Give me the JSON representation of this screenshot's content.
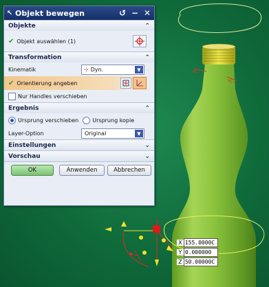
{
  "dialog": {
    "title": "Objekt bewegen",
    "sections": {
      "objekte": {
        "title": "Objekte",
        "select_label": "Objekt auswählen (1)"
      },
      "transformation": {
        "title": "Transformation",
        "kinematik_label": "Kinematik",
        "kinematik_value": "Dyn.",
        "orientation_label": "Orientierung angeben",
        "handles_label": "Nur Handles verschieben"
      },
      "ergebnis": {
        "title": "Ergebnis",
        "radio_move": "Ursprung verschieben",
        "radio_copy": "Ursprung kopie",
        "layer_label": "Layer-Option",
        "layer_value": "Original"
      },
      "einstellungen": {
        "title": "Einstellungen"
      },
      "vorschau": {
        "title": "Vorschau"
      }
    },
    "buttons": {
      "ok": "OK",
      "apply": "Anwenden",
      "cancel": "Abbrechen"
    }
  },
  "coordinates": {
    "x_label": "X",
    "x_value": "155.0000C",
    "y_label": "Y",
    "y_value": "0.000000",
    "z_label": "Z",
    "z_value": "50.00000C"
  },
  "colors": {
    "viewport_bg": "#1a7d48",
    "bottle": "#7fbf3a",
    "title_bar": "#1d3b78",
    "ok_button": "#8fd08a"
  }
}
